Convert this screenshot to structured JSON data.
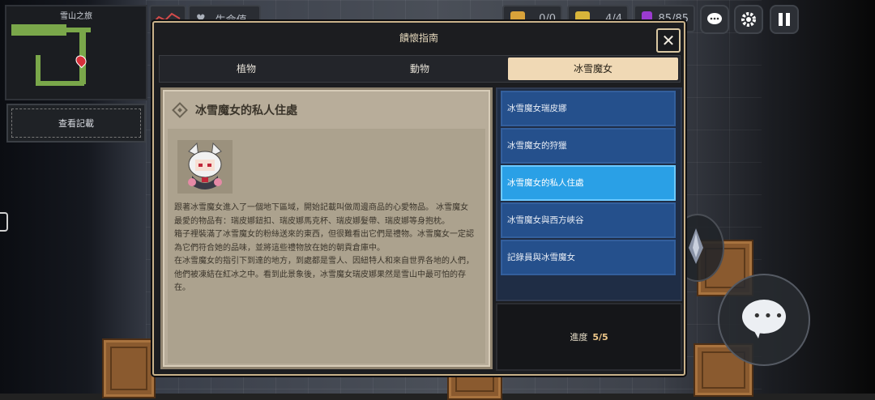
{
  "minimap": {
    "title": "雪山之旅"
  },
  "record_button": {
    "label": "查看記載"
  },
  "hud": {
    "life_label": "生命值",
    "stat1": "0/0",
    "stat2": "4/4",
    "stat3": "85/85"
  },
  "dialog": {
    "title": "饋懷指南",
    "close_icon": "close-icon",
    "tabs": [
      {
        "label": "植物",
        "active": false
      },
      {
        "label": "動物",
        "active": false
      },
      {
        "label": "冰雪魔女",
        "active": true
      }
    ],
    "entry": {
      "title": "冰雪魔女的私人住處",
      "paragraphs": [
        "跟著冰雪魔女進入了一個地下區域，開始記載叫做周邊商品的心愛物品。 冰雪魔女最愛的物品有：瑞皮娜鈕扣、瑞皮娜馬克杯、瑞皮娜髮帶、瑞皮娜等身抱枕。",
        "箱子裡裝滿了冰雪魔女的粉絲送來的東西，但很難看出它們是禮物。冰雪魔女一定認為它們符合她的品味，並將這些禮物放在她的朝貢倉庫中。",
        "在冰雪魔女的指引下到達的地方，到處都是雪人、因紐特人和來自世界各地的人們，他們被凍結在紅冰之中。看到此景象後，冰雪魔女瑞皮娜果然是雪山中最可怕的存在。"
      ]
    },
    "list": [
      {
        "label": "冰雪魔女瑞皮娜",
        "active": false
      },
      {
        "label": "冰雪魔女的狩獵",
        "active": false
      },
      {
        "label": "冰雪魔女的私人住處",
        "active": true
      },
      {
        "label": "冰雪魔女與西方峽谷",
        "active": false
      },
      {
        "label": "記錄員與冰雪魔女",
        "active": false
      }
    ],
    "progress": {
      "label": "進度",
      "value": "5/5"
    }
  },
  "colors": {
    "accent_tab": "#f0d9b5",
    "list_item": "#25508c",
    "list_item_active": "#2aa0e6",
    "progress_value": "#f0c98a"
  }
}
